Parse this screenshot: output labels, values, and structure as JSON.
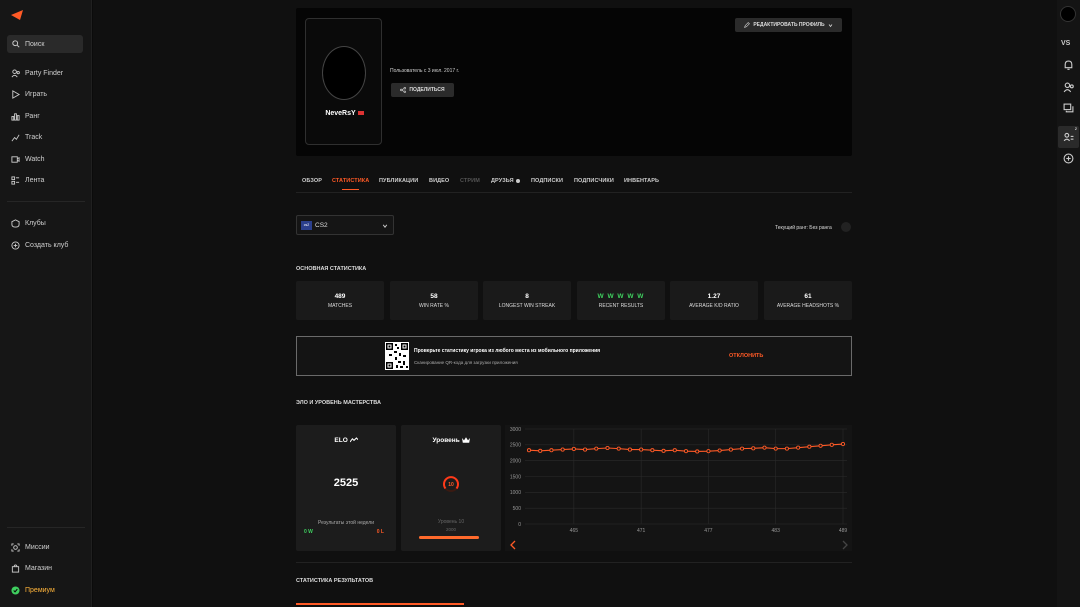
{
  "sidebar": {
    "search_label": "Поиск",
    "items": [
      {
        "label": "Party Finder",
        "icon": "party-icon"
      },
      {
        "label": "Играть",
        "icon": "play-icon"
      },
      {
        "label": "Ранг",
        "icon": "rank-icon"
      },
      {
        "label": "Track",
        "icon": "track-icon"
      },
      {
        "label": "Watch",
        "icon": "watch-icon"
      },
      {
        "label": "Лента",
        "icon": "feed-icon"
      },
      {
        "label": "Клубы",
        "icon": "clubs-icon"
      },
      {
        "label": "Создать клуб",
        "icon": "create-club-icon"
      }
    ],
    "bottom": [
      {
        "label": "Миссии",
        "icon": "missions-icon"
      },
      {
        "label": "Магазин",
        "icon": "shop-icon"
      },
      {
        "label": "Премиум",
        "icon": "premium-icon"
      }
    ]
  },
  "rightbar": {
    "vs_label": "VS",
    "friends_badge": "2"
  },
  "profile": {
    "nickname": "NeveRsY",
    "member_since": "Пользователь с 3 июл. 2017 г.",
    "share_label": "ПОДЕЛИТЬСЯ",
    "edit_label": "РЕДАКТИРОВАТЬ ПРОФИЛЬ"
  },
  "tabs": [
    "ОБЗОР",
    "СТАТИСТИКА",
    "ПУБЛИКАЦИИ",
    "ВИДЕО",
    "СТРИМ",
    "ДРУЗЬЯ",
    "ПОДПИСКИ",
    "ПОДПИСЧИКИ",
    "ИНВЕНТАРЬ"
  ],
  "game": {
    "badge": "cs2",
    "name": "CS2"
  },
  "rank_label": "Текущий ранг: Без ранга",
  "main_stats": {
    "title": "ОСНОВНАЯ СТАТИСТИКА",
    "cards": [
      {
        "value": "489",
        "label": "MATCHES"
      },
      {
        "value": "58",
        "label": "WIN RATE %"
      },
      {
        "value": "8",
        "label": "LONGEST WIN STREAK"
      },
      {
        "value": "W W W W W",
        "label": "RECENT RESULTS"
      },
      {
        "value": "1.27",
        "label": "AVERAGE K/D RATIO"
      },
      {
        "value": "61",
        "label": "AVERAGE HEADSHOTS %"
      }
    ]
  },
  "banner": {
    "text": "Проверьте статистику игрока из любого места из мобильного приложения",
    "subtext": "Сканирование QR-кода для загрузки приложения",
    "decline_label": "ОТКЛОНИТЬ"
  },
  "elo_section": {
    "title": "ЭЛО И УРОВЕНЬ МАСТЕРСТВА",
    "elo_title": "ELO",
    "elo_value": "2525",
    "week_label": "Результаты этой недели",
    "wins": "0 W",
    "losses": "0 L",
    "level_title": "Уровень",
    "level_number": "10",
    "level_label": "Уровень 10",
    "level_elo": "2000",
    "level_progress": 1.0
  },
  "results_title": "СТАТИСТИКА РЕЗУЛЬТАТОВ",
  "chart_data": {
    "type": "line",
    "x": [
      461,
      462,
      463,
      464,
      465,
      466,
      467,
      468,
      469,
      470,
      471,
      472,
      473,
      474,
      475,
      476,
      477,
      478,
      479,
      480,
      481,
      482,
      483,
      484,
      485,
      486,
      487,
      488,
      489
    ],
    "values": [
      2330,
      2310,
      2330,
      2350,
      2370,
      2350,
      2380,
      2400,
      2380,
      2350,
      2350,
      2330,
      2310,
      2330,
      2300,
      2290,
      2300,
      2320,
      2350,
      2380,
      2390,
      2410,
      2380,
      2380,
      2410,
      2440,
      2470,
      2500,
      2525
    ],
    "x_ticks": [
      465,
      471,
      477,
      483,
      489
    ],
    "y_ticks": [
      0,
      500,
      1000,
      1500,
      2000,
      2500,
      3000
    ],
    "ylim": [
      0,
      3000
    ],
    "color": "#ff5a26",
    "grid": true
  }
}
